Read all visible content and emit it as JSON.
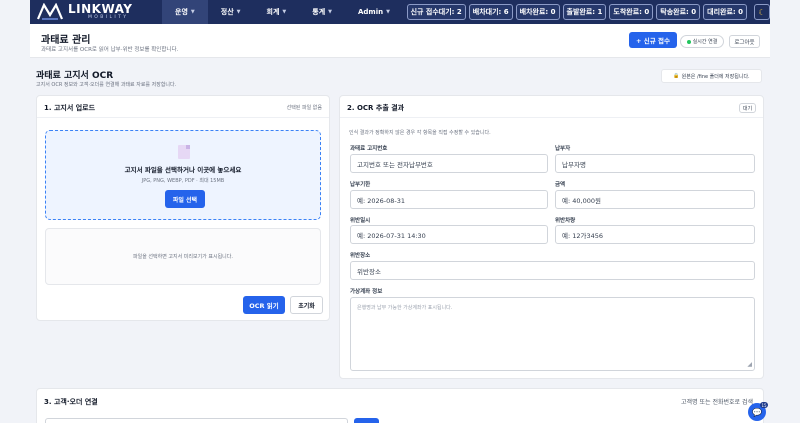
{
  "brand": {
    "name": "LINKWAY",
    "sub": "MOBILITY"
  },
  "nav": [
    {
      "label": "운영",
      "active": true
    },
    {
      "label": "정산",
      "active": false
    },
    {
      "label": "회계",
      "active": false
    },
    {
      "label": "통계",
      "active": false
    },
    {
      "label": "Admin",
      "active": false
    }
  ],
  "counters": [
    "신규 접수대기: 2",
    "배차대기: 6",
    "배차완료: 0",
    "출발완료: 1",
    "도착완료: 0",
    "탁송완료: 0",
    "대리완료: 0"
  ],
  "header": {
    "title": "과태료 관리",
    "subtitle": "과태료 고지서를 OCR로 읽어 납부·위반 정보를 확인합니다.",
    "new_button": "+ 신규 접수",
    "live_label": "실시간 연결",
    "logout": "로그아웃"
  },
  "section": {
    "title": "과태료 고지서 OCR",
    "subtitle": "고지서 OCR 정보와 고객·오더를 연결해 과태료 자료를 저장합니다.",
    "save_info": "원본은 /fine 폴더에 저장됩니다."
  },
  "upload": {
    "title": "1. 고지서 업로드",
    "status": "선택된 파일 없음",
    "dz_title": "고지서 파일을 선택하거나 이곳에 놓으세요",
    "dz_formats": "JPG, PNG, WEBP, PDF · 최대 15MB",
    "pick_button": "파일 선택",
    "preview_hint": "파일을 선택하면 고지서 미리보기가 표시됩니다.",
    "ocr_button": "OCR 읽기",
    "reset_button": "초기화"
  },
  "ocr": {
    "title": "2. OCR 추출 결과",
    "badge": "대기",
    "hint": "인식 결과가 정확하지 않은 경우 각 항목을 직접 수정할 수 있습니다.",
    "fields": {
      "notice_no": {
        "label": "과태료 고지번호",
        "placeholder": "고지번호 또는 전자납부번호"
      },
      "payer": {
        "label": "납부자",
        "placeholder": "납부자명"
      },
      "due_date": {
        "label": "납부기한",
        "placeholder": "예: 2026-08-31"
      },
      "amount": {
        "label": "금액",
        "placeholder": "예: 40,000원"
      },
      "violation_dt": {
        "label": "위반일시",
        "placeholder": "예: 2026-07-31 14:30"
      },
      "vehicle": {
        "label": "위반차량",
        "placeholder": "예: 12가3456"
      },
      "place": {
        "label": "위반장소",
        "placeholder": "위반장소"
      },
      "virtual_account": {
        "label": "가상계좌 정보",
        "placeholder": "은행명과 납부 가능한 가상계좌가 표시됩니다."
      }
    }
  },
  "link": {
    "title": "3. 고객·오더 연결",
    "hint": "고객명 또는 전화번호로 검색"
  },
  "chat_badge": "15"
}
